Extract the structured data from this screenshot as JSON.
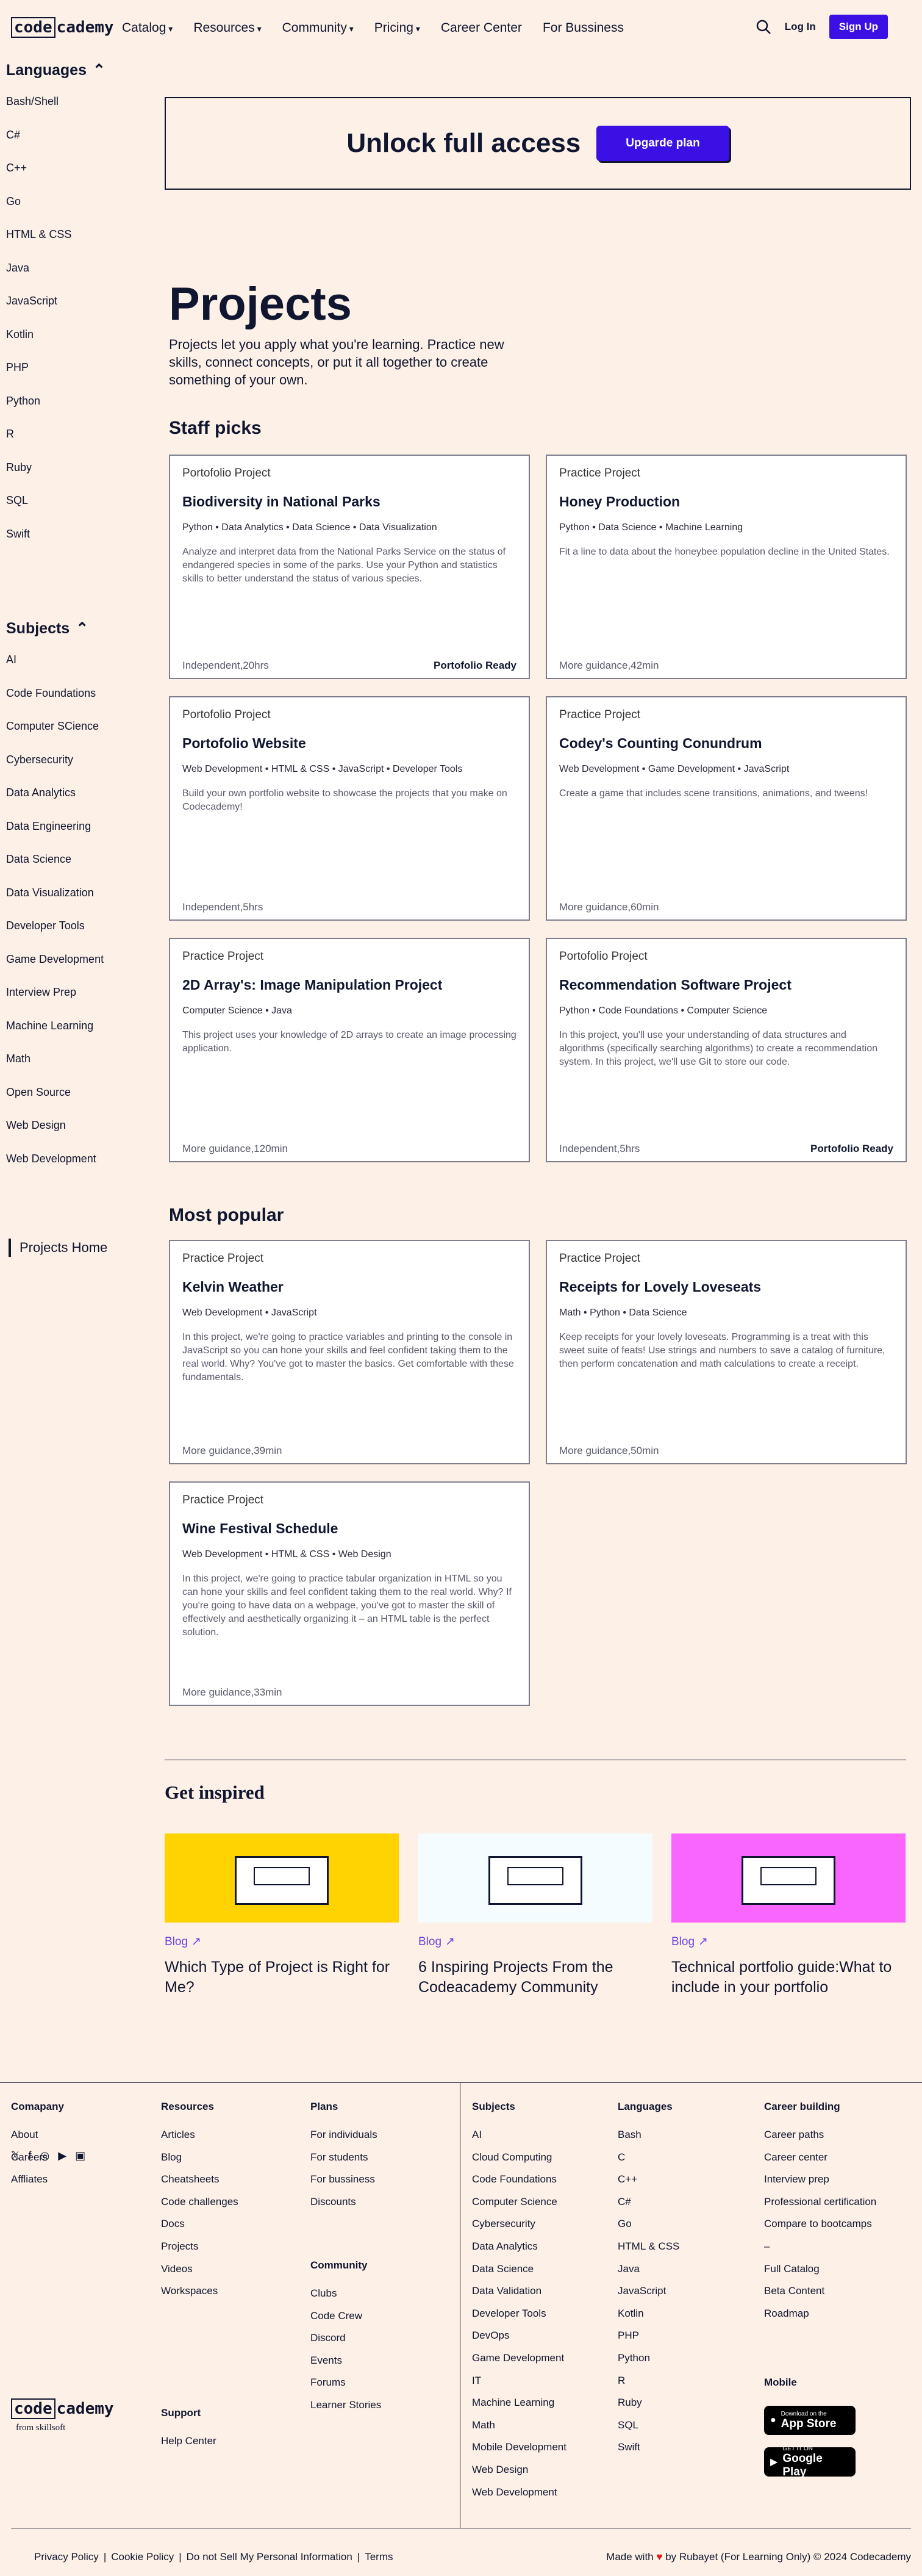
{
  "nav": {
    "logo_box": "code",
    "logo_rest": "cademy",
    "links": [
      "Catalog",
      "Resources",
      "Community",
      "Pricing",
      "Career Center",
      "For Bussiness"
    ],
    "dropdowns": [
      true,
      true,
      true,
      true,
      false,
      false
    ],
    "login": "Log In",
    "signup": "Sign Up"
  },
  "sidebar": {
    "languages_title": "Languages",
    "languages": [
      "Bash/Shell",
      "C#",
      "C++",
      "Go",
      "HTML & CSS",
      "Java",
      "JavaScript",
      "Kotlin",
      "PHP",
      "Python",
      "R",
      "Ruby",
      "SQL",
      "Swift"
    ],
    "subjects_title": "Subjects",
    "subjects": [
      "AI",
      "Code Foundations",
      "Computer SCience",
      "Cybersecurity",
      "Data Analytics",
      "Data Engineering",
      "Data Science",
      "Data Visualization",
      "Developer Tools",
      "Game Development",
      "Interview Prep",
      "Machine Learning",
      "Math",
      "Open Source",
      "Web Design",
      "Web Development"
    ],
    "projects_home": "Projects Home"
  },
  "banner": {
    "text": "Unlock full access",
    "button": "Upgarde plan"
  },
  "page": {
    "title": "Projects",
    "description": "Projects let you apply what you're learning. Practice new skills, connect concepts, or put it all together to create something of your own.",
    "staff_picks": "Staff picks",
    "most_popular": "Most popular"
  },
  "staff": [
    {
      "kind": "Portofolio Project",
      "title": "Biodiversity in National Parks",
      "tags": "Python • Data Analytics • Data Science • Data Visualization",
      "desc": "Analyze and interpret data from the National Parks Service on the status of endangered species in some of the parks. Use your Python and statistics skills to better understand the status of various species.",
      "meta": "Independent,20hrs",
      "badge": "Portofolio Ready"
    },
    {
      "kind": "Practice Project",
      "title": "Honey Production",
      "tags": "Python • Data Science • Machine Learning",
      "desc": "Fit a line to data about the honeybee population decline in the United States.",
      "meta": "More guidance,42min",
      "badge": ""
    },
    {
      "kind": "Portofolio Project",
      "title": "Portofolio Website",
      "tags": "Web Development • HTML & CSS • JavaScript • Developer Tools",
      "desc": "Build your own portfolio website to showcase the projects that you make on Codecademy!",
      "meta": "Independent,5hrs",
      "badge": ""
    },
    {
      "kind": "Practice Project",
      "title": "Codey's Counting Conundrum",
      "tags": "Web Development • Game Development • JavaScript",
      "desc": "Create a game that includes scene transitions, animations, and tweens!",
      "meta": "More guidance,60min",
      "badge": ""
    },
    {
      "kind": "Practice Project",
      "title": "2D Array's: Image Manipulation Project",
      "tags": "Computer Science • Java",
      "desc": "This project uses your knowledge of 2D arrays to create an image processing application.",
      "meta": "More guidance,120min",
      "badge": ""
    },
    {
      "kind": "Portofolio Project",
      "title": "Recommendation Software Project",
      "tags": "Python • Code Foundations • Computer Science",
      "desc": "In this project, you'll use your understanding of data structures and algorithms (specifically searching algorithms) to create a recommendation system. In this project, we'll use Git to store our code.",
      "meta": "Independent,5hrs",
      "badge": "Portofolio Ready"
    }
  ],
  "popular": [
    {
      "kind": "Practice Project",
      "title": "Kelvin Weather",
      "tags": "Web Development • JavaScript",
      "desc": "In this project, we're going to practice variables and printing to the console in JavaScript so you can hone your skills and feel confident taking them to the real world. Why? You've got to master the basics. Get comfortable with these fundamentals.",
      "meta": "More guidance,39min",
      "badge": ""
    },
    {
      "kind": "Practice Project",
      "title": "Receipts for Lovely Loveseats",
      "tags": "Math • Python • Data Science",
      "desc": "Keep receipts for your lovely loveseats. Programming is a treat with this sweet suite of feats! Use strings and numbers to save a catalog of furniture, then perform concatenation and math calculations to create a receipt.",
      "meta": "More guidance,50min",
      "badge": ""
    },
    {
      "kind": "Practice Project",
      "title": "Wine Festival Schedule",
      "tags": "Web Development • HTML & CSS • Web Design",
      "desc": "In this project, we're going to practice tabular organization in HTML so you can hone your skills and feel confident taking them to the real world. Why? If you're going to have data on a webpage, you've got to master the skill of effectively and aesthetically organizing it – an HTML table is the perfect solution.",
      "meta": "More guidance,33min",
      "badge": ""
    }
  ],
  "inspired": {
    "title": "Get inspired",
    "items": [
      {
        "label": "Blog",
        "title": "Which Type of Project is Right for Me?",
        "color": "#ffd300"
      },
      {
        "label": "Blog",
        "title": "6 Inspiring Projects From the Codeacademy Community",
        "color": "#f5fcff"
      },
      {
        "label": "Blog",
        "title": "Technical portfolio guide:What to include in your portfolio",
        "color": "#f966ff"
      }
    ]
  },
  "footer": {
    "company": {
      "title": "Comapany",
      "items": [
        "About",
        "Careers",
        "Affliates"
      ]
    },
    "resources": {
      "title": "Resources",
      "items": [
        "Articles",
        "Blog",
        "Cheatsheets",
        "Code challenges",
        "Docs",
        "Projects",
        "Videos",
        "Workspaces"
      ]
    },
    "plans": {
      "title": "Plans",
      "items": [
        "For individuals",
        "For students",
        "For bussiness",
        "Discounts"
      ]
    },
    "community": {
      "title": "Community",
      "items": [
        "Clubs",
        "Code Crew",
        "Discord",
        "Events",
        "Forums",
        "Learner Stories"
      ]
    },
    "support": {
      "title": "Support",
      "items": [
        "Help Center"
      ]
    },
    "subjects": {
      "title": "Subjects",
      "items": [
        "AI",
        "Cloud Computing",
        "Code Foundations",
        "Computer Science",
        "Cybersecurity",
        "Data Analytics",
        "Data Science",
        "Data Validation",
        "Developer Tools",
        "DevOps",
        "Game Development",
        "IT",
        "Machine Learning",
        "Math",
        "Mobile Development",
        "Web Design",
        "Web Development"
      ]
    },
    "languages": {
      "title": "Languages",
      "items": [
        "Bash",
        "C",
        "C++",
        "C#",
        "Go",
        "HTML & CSS",
        "Java",
        "JavaScript",
        "Kotlin",
        "PHP",
        "Python",
        "R",
        "Ruby",
        "SQL",
        "Swift"
      ]
    },
    "career": {
      "title": "Career building",
      "items": [
        "Career paths",
        "Career center",
        "Interview prep",
        "Professional certification",
        "Compare to bootcamps",
        "–",
        "Full Catalog",
        "Beta Content",
        "Roadmap"
      ]
    },
    "mobile": "Mobile",
    "appstore_small": "Download on the",
    "appstore": "App Store",
    "googleplay_small": "GET IT ON",
    "googleplay": "Google Play",
    "from": "from skillsoft",
    "legal": [
      "Privacy Policy",
      "Cookie Policy",
      "Do not Sell My Personal Information",
      "Terms"
    ],
    "copyright_pre": "Made with",
    "copyright_post": "by Rubayet (For Learning Only) © 2024 Codecademy"
  }
}
